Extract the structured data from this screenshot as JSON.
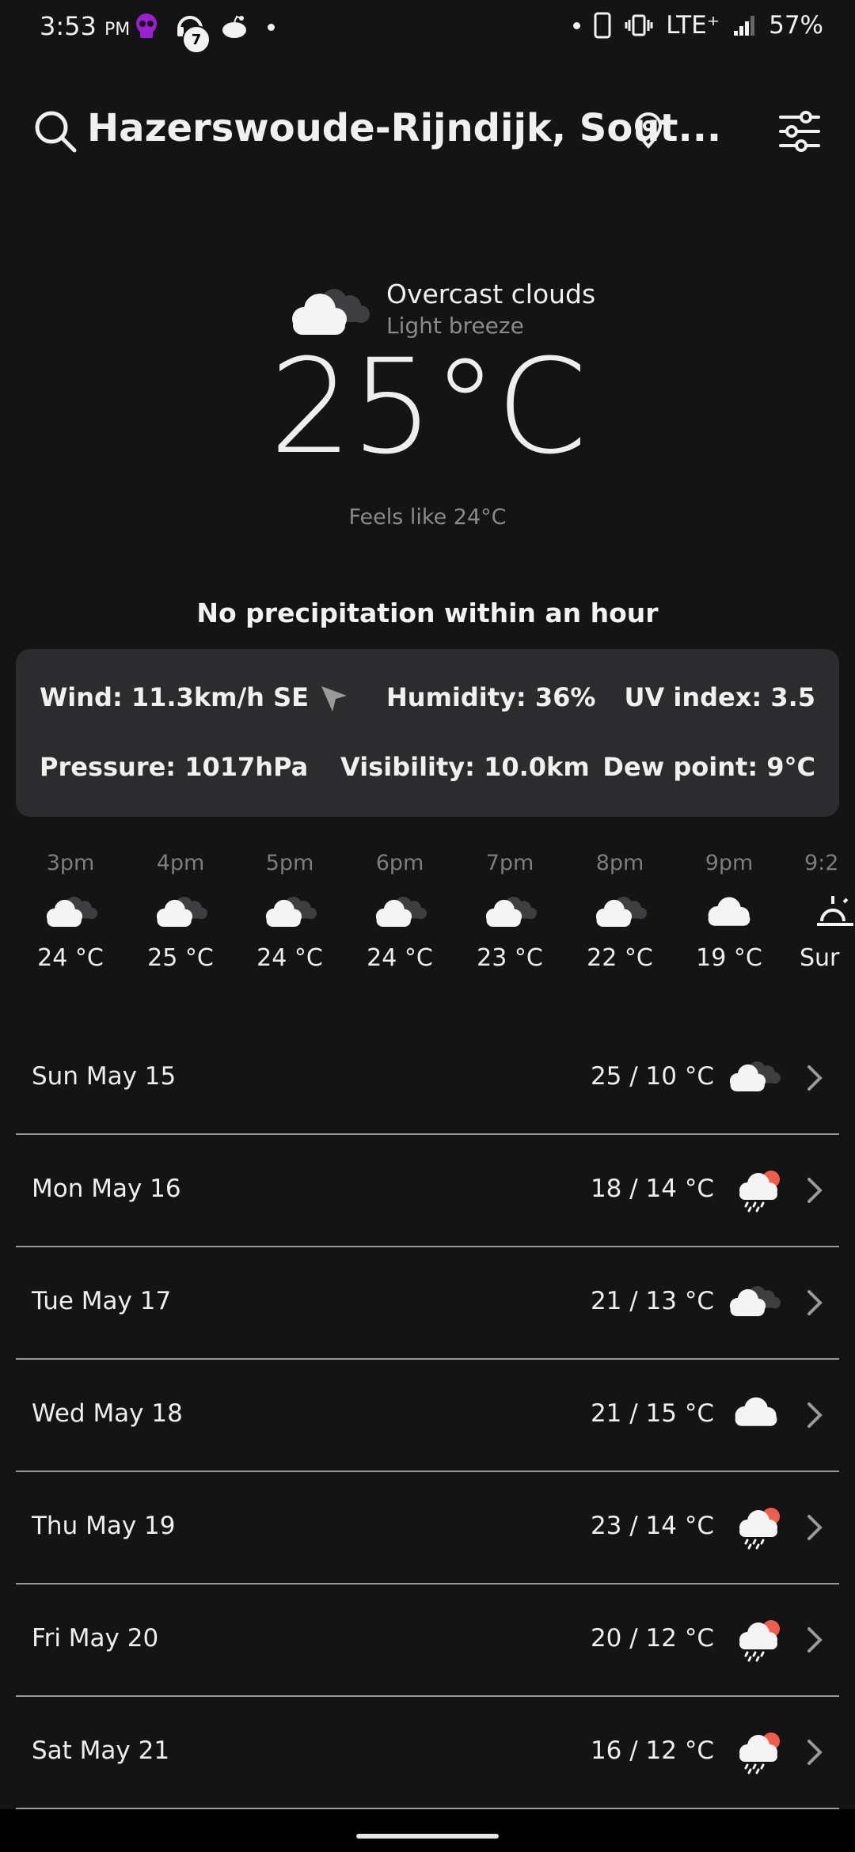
{
  "status_bar": {
    "time": "3:53",
    "ampm": "PM",
    "notif_badge": "7",
    "network": "LTE⁺",
    "battery": "57%"
  },
  "header": {
    "location": "Hazerswoude-Rijndijk, Sout..."
  },
  "current": {
    "condition": "Overcast clouds",
    "wind_desc": "Light breeze",
    "temperature": "25°C",
    "feels_like": "Feels like 24°C",
    "precipitation": "No precipitation within an hour"
  },
  "details": {
    "wind": "Wind: 11.3km/h SE",
    "humidity": "Humidity: 36%",
    "uv": "UV index: 3.5",
    "pressure": "Pressure: 1017hPa",
    "visibility": "Visibility: 10.0km",
    "dew_point": "Dew point: 9°C"
  },
  "hourly": [
    {
      "time": "3pm",
      "icon": "overcast-cloud-icon",
      "temp": "24 °C"
    },
    {
      "time": "4pm",
      "icon": "overcast-cloud-icon",
      "temp": "25 °C"
    },
    {
      "time": "5pm",
      "icon": "overcast-cloud-icon",
      "temp": "24 °C"
    },
    {
      "time": "6pm",
      "icon": "overcast-cloud-icon",
      "temp": "24 °C"
    },
    {
      "time": "7pm",
      "icon": "overcast-cloud-icon",
      "temp": "23 °C"
    },
    {
      "time": "8pm",
      "icon": "overcast-cloud-icon",
      "temp": "22 °C"
    },
    {
      "time": "9pm",
      "icon": "cloud-icon",
      "temp": "19 °C"
    },
    {
      "time": "9:2",
      "icon": "sunset-icon",
      "temp": "Sur"
    }
  ],
  "daily": [
    {
      "day": "Sun May 15",
      "temps": "25 / 10 °C",
      "icon": "overcast-cloud-icon"
    },
    {
      "day": "Mon May 16",
      "temps": "18 / 14 °C",
      "icon": "rain-sun-icon"
    },
    {
      "day": "Tue May 17",
      "temps": "21 / 13 °C",
      "icon": "overcast-cloud-icon"
    },
    {
      "day": "Wed May 18",
      "temps": "21 / 15 °C",
      "icon": "cloud-icon"
    },
    {
      "day": "Thu May 19",
      "temps": "23 / 14 °C",
      "icon": "rain-sun-icon"
    },
    {
      "day": "Fri May 20",
      "temps": "20 / 12 °C",
      "icon": "rain-sun-icon"
    },
    {
      "day": "Sat May 21",
      "temps": "16 / 12 °C",
      "icon": "rain-sun-icon"
    }
  ],
  "colors": {
    "background": "#141415",
    "card": "#2c2c2e",
    "sun_accent": "#f25c4a",
    "muted_text": "#8a8a8a"
  }
}
